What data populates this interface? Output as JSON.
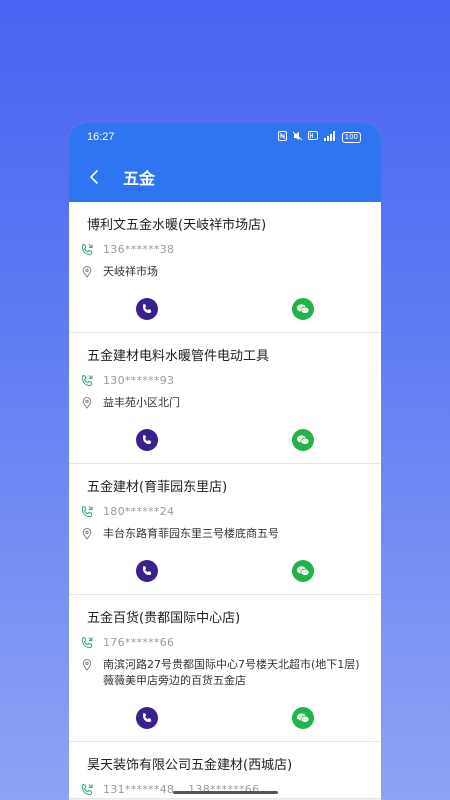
{
  "status": {
    "time": "16:27",
    "battery": "100"
  },
  "nav": {
    "title": "五金"
  },
  "stores": [
    {
      "name": "博利文五金水暖(天岐祥市场店)",
      "phones": [
        "136******38"
      ],
      "address": "天岐祥市场"
    },
    {
      "name": "五金建材电料水暖管件电动工具",
      "phones": [
        "130******93"
      ],
      "address": "益丰苑小区北门"
    },
    {
      "name": "五金建材(育菲园东里店)",
      "phones": [
        "180******24"
      ],
      "address": "丰台东路育菲园东里三号楼底商五号"
    },
    {
      "name": "五金百货(贵都国际中心店)",
      "phones": [
        "176******66"
      ],
      "address": "南滨河路27号贵都国际中心7号楼天北超市(地下1层)薇薇美甲店旁边的百货五金店"
    },
    {
      "name": "昊天装饰有限公司五金建材(西城店)",
      "phones": [
        "131******48",
        "138******66"
      ],
      "address": ""
    }
  ]
}
